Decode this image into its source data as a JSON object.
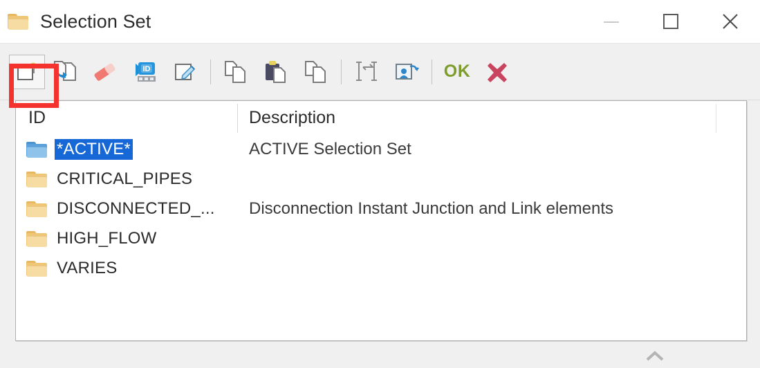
{
  "window": {
    "title": "Selection Set",
    "icon": "folder-icon",
    "controls": [
      {
        "name": "minimize-button",
        "glyph": "minimize",
        "enabled": false
      },
      {
        "name": "maximize-button",
        "glyph": "maximize",
        "enabled": true
      },
      {
        "name": "close-button",
        "glyph": "close",
        "enabled": true
      }
    ]
  },
  "toolbar": {
    "highlight_color": "#f4332f",
    "ok_label": "OK",
    "ok_color": "#7e9c2c",
    "cancel_color": "#c9455f",
    "items": [
      {
        "name": "new-selection-set-button",
        "icon": "new-document-icon",
        "highlighted": true
      },
      {
        "name": "copy-selection-set-button",
        "icon": "copy-arrow-icon",
        "highlighted": false
      },
      {
        "name": "delete-selection-set-button",
        "icon": "eraser-icon",
        "highlighted": false
      },
      {
        "name": "edit-id-button",
        "icon": "id-tag-icon",
        "highlighted": false
      },
      {
        "name": "edit-properties-button",
        "icon": "edit-pencil-icon",
        "highlighted": false
      },
      {
        "name": "copy-button",
        "icon": "copy-icon",
        "highlighted": false
      },
      {
        "name": "paste-button",
        "icon": "paste-icon",
        "highlighted": false
      },
      {
        "name": "duplicate-button",
        "icon": "duplicate-icon",
        "highlighted": false
      },
      {
        "name": "fit-extents-button",
        "icon": "expand-arrows-icon",
        "highlighted": false
      },
      {
        "name": "export-button",
        "icon": "export-image-icon",
        "highlighted": false
      },
      {
        "name": "ok-button",
        "icon": "ok-text-icon",
        "highlighted": false
      },
      {
        "name": "cancel-button",
        "icon": "red-x-icon",
        "highlighted": false
      }
    ]
  },
  "list": {
    "columns": [
      {
        "key": "id",
        "label": "ID"
      },
      {
        "key": "description",
        "label": "Description"
      }
    ],
    "selection_color": "#1668d6",
    "rows": [
      {
        "id": "*ACTIVE*",
        "description": "ACTIVE Selection Set",
        "selected": true,
        "icon": "folder-icon-blue"
      },
      {
        "id": "CRITICAL_PIPES",
        "description": "",
        "selected": false,
        "icon": "folder-icon"
      },
      {
        "id": "DISCONNECTED_...",
        "description": "Disconnection Instant Junction and Link elements",
        "selected": false,
        "icon": "folder-icon"
      },
      {
        "id": "HIGH_FLOW",
        "description": "",
        "selected": false,
        "icon": "folder-icon"
      },
      {
        "id": "VARIES",
        "description": "",
        "selected": false,
        "icon": "folder-icon"
      }
    ]
  },
  "footer": {
    "resize_handle": "chevron-up-icon"
  }
}
